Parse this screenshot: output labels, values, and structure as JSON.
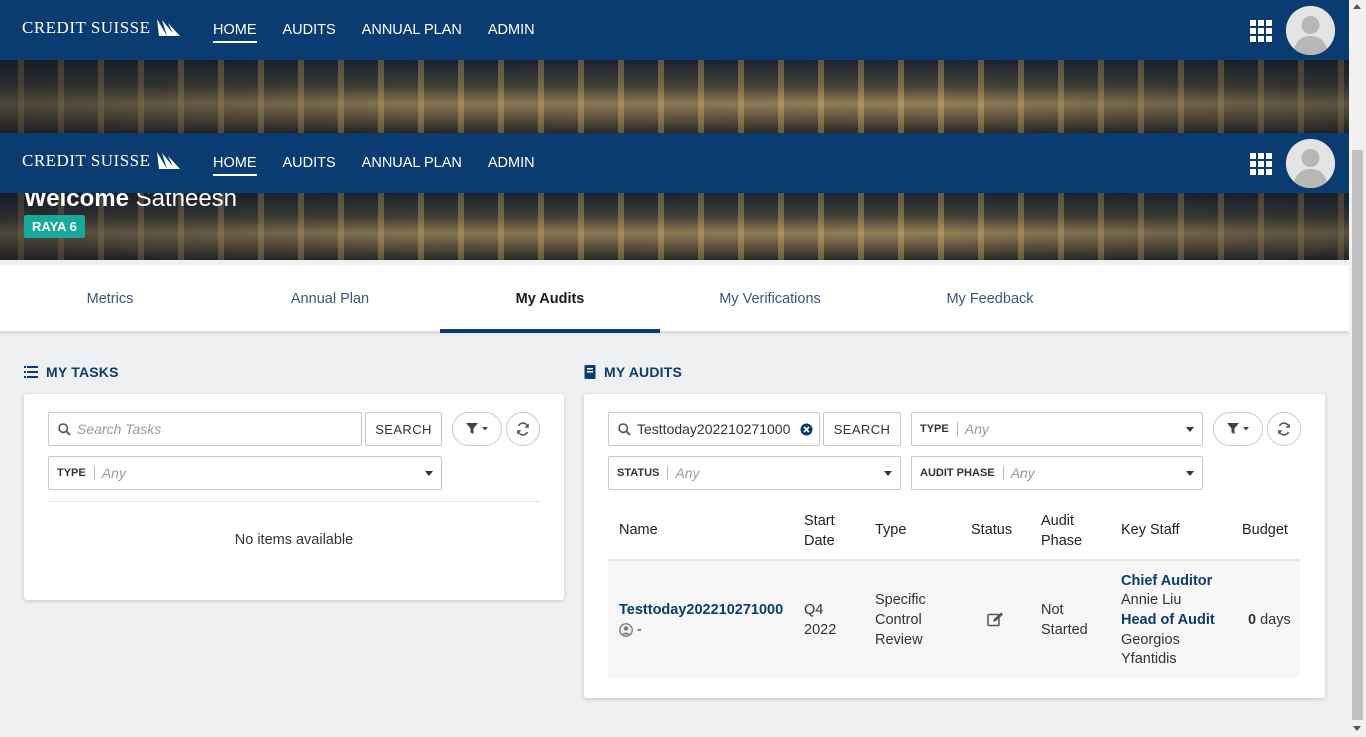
{
  "brand": "CREDIT SUISSE",
  "nav": {
    "items": [
      "HOME",
      "AUDITS",
      "ANNUAL PLAN",
      "ADMIN"
    ],
    "active": "HOME"
  },
  "welcome": {
    "prefix": "Welcome",
    "name": "Satheesh",
    "badge": "RAYA 6"
  },
  "tabs": {
    "items": [
      "Metrics",
      "Annual Plan",
      "My Audits",
      "My Verifications",
      "My Feedback"
    ],
    "active": "My Audits"
  },
  "tasks": {
    "title": "MY TASKS",
    "search_placeholder": "Search Tasks",
    "search_button": "SEARCH",
    "type_label": "TYPE",
    "type_value": "Any",
    "empty": "No items available"
  },
  "audits": {
    "title": "MY AUDITS",
    "search_value": "Testtoday202210271000",
    "search_button": "SEARCH",
    "type_label": "TYPE",
    "type_value": "Any",
    "status_label": "STATUS",
    "status_value": "Any",
    "phase_label": "AUDIT PHASE",
    "phase_value": "Any",
    "columns": [
      "Name",
      "Start Date",
      "Type",
      "Status",
      "Audit Phase",
      "Key Staff",
      "Budget"
    ],
    "rows": [
      {
        "name": "Testtoday202210271000",
        "owner": "-",
        "start_q": "Q4",
        "start_y": "2022",
        "type": [
          "Specific",
          "Control",
          "Review"
        ],
        "status_icon": "edit-icon",
        "phase": [
          "Not",
          "Started"
        ],
        "staff": [
          {
            "role": "Chief Auditor",
            "names": [
              "Annie Liu"
            ]
          },
          {
            "role": "Head of Audit",
            "names": [
              "Georgios",
              "Yfantidis"
            ]
          }
        ],
        "budget_value": "0",
        "budget_unit": "days"
      }
    ]
  },
  "colors": {
    "primary": "#0a3b71",
    "badge": "#17a99a"
  }
}
